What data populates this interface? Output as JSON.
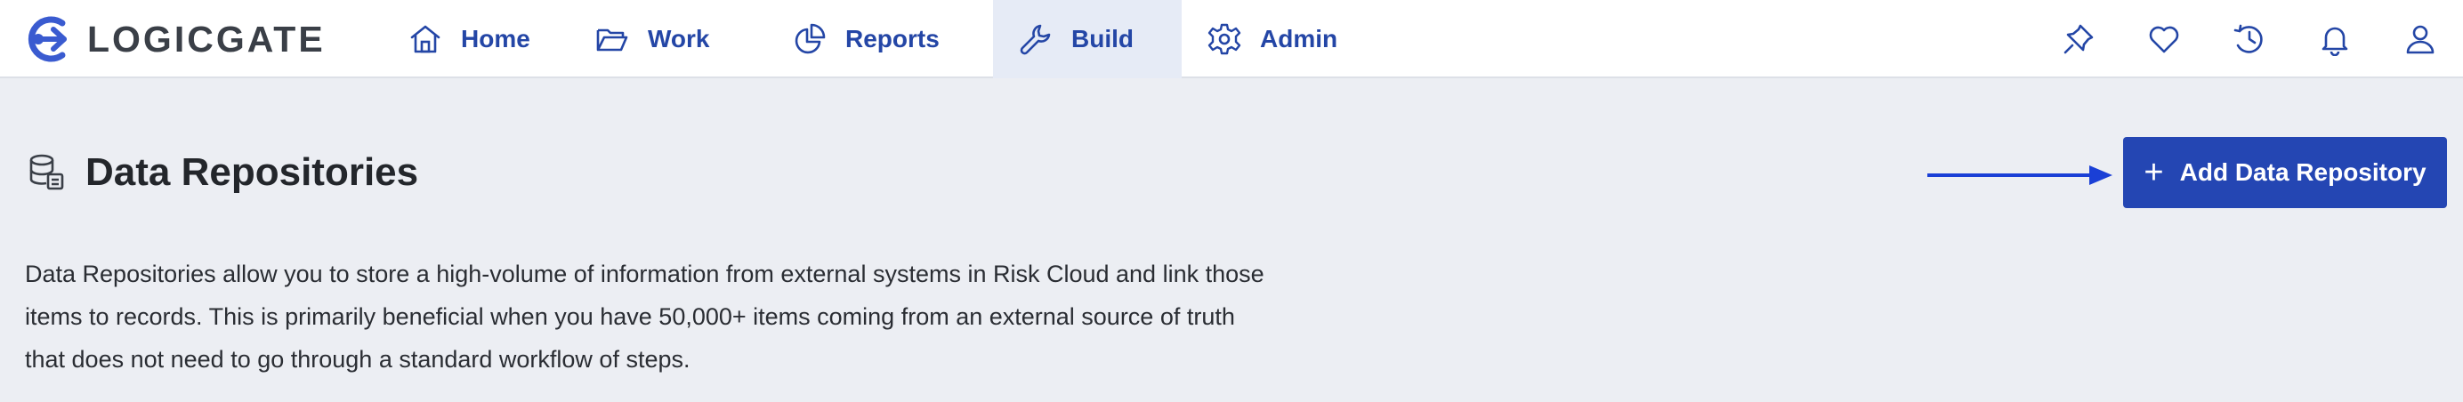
{
  "brand": {
    "name": "LOGICGATE"
  },
  "nav": {
    "items": [
      {
        "label": "Home",
        "icon": "home-icon"
      },
      {
        "label": "Work",
        "icon": "folder-icon"
      },
      {
        "label": "Reports",
        "icon": "pie-chart-icon"
      },
      {
        "label": "Build",
        "icon": "wrench-icon",
        "active": true
      },
      {
        "label": "Admin",
        "icon": "gear-icon"
      }
    ]
  },
  "utility_icons": [
    "pin-icon",
    "heart-icon",
    "history-icon",
    "bell-icon",
    "user-icon"
  ],
  "page": {
    "title": "Data Repositories",
    "icon": "database-icon",
    "add_button_label": "Add Data Repository",
    "description": "Data Repositories allow you to store a high-volume of information from external systems in Risk Cloud and link those items to records. This is primarily beneficial when you have 50,000+ items coming from an external source of truth that does not need to go through a standard workflow of steps."
  },
  "colors": {
    "accent": "#2446b3",
    "nav_text": "#2446a6",
    "active_nav_bg": "#e6ebf6",
    "page_bg": "#eceef3"
  }
}
